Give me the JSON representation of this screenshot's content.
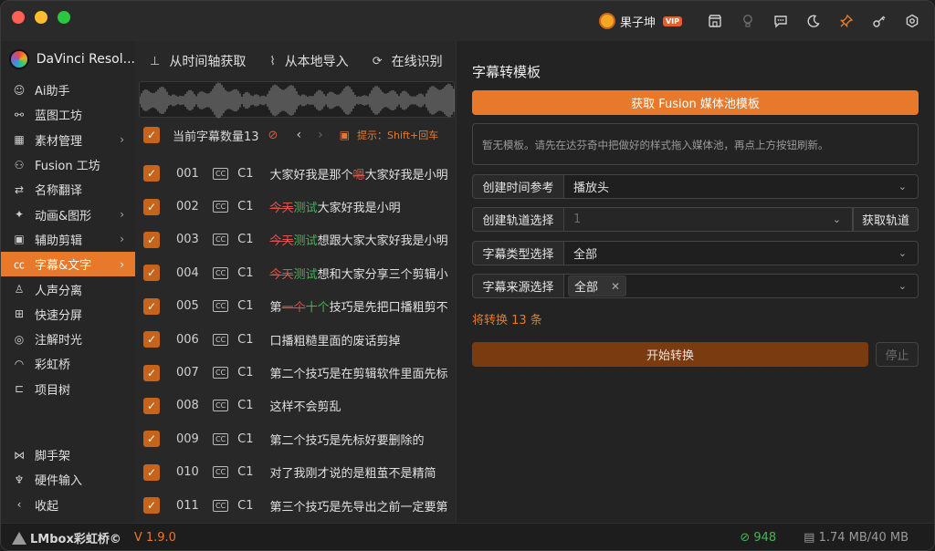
{
  "titlebar": {
    "user_name": "果子坤",
    "vip_badge": "VIP",
    "icons": [
      "store-icon",
      "lightbulb-icon",
      "message-icon",
      "moon-icon",
      "pin-icon",
      "key-icon",
      "settings-icon"
    ]
  },
  "sidebar": {
    "app_name": "DaVinci Resol...",
    "items": [
      {
        "label": "Ai助手",
        "icon": "robot-icon"
      },
      {
        "label": "蓝图工坊",
        "icon": "blueprint-icon"
      },
      {
        "label": "素材管理",
        "icon": "grid-icon",
        "has_submenu": true
      },
      {
        "label": "Fusion 工坊",
        "icon": "nodes-icon"
      },
      {
        "label": "名称翻译",
        "icon": "translate-icon"
      },
      {
        "label": "动画&图形",
        "icon": "sparkle-icon",
        "has_submenu": true
      },
      {
        "label": "辅助剪辑",
        "icon": "clip-icon",
        "has_submenu": true
      },
      {
        "label": "字幕&文字",
        "icon": "cc-icon",
        "has_submenu": true,
        "active": true
      },
      {
        "label": "人声分离",
        "icon": "person-icon"
      },
      {
        "label": "快速分屏",
        "icon": "split-icon"
      },
      {
        "label": "注解时光",
        "icon": "note-icon"
      },
      {
        "label": "彩虹桥",
        "icon": "rainbow-icon"
      },
      {
        "label": "项目树",
        "icon": "tree-icon"
      }
    ],
    "bottom_items": [
      {
        "label": "脚手架",
        "icon": "scaffold-icon"
      },
      {
        "label": "硬件输入",
        "icon": "joystick-icon"
      },
      {
        "label": "收起",
        "icon": "chevron-left-icon"
      }
    ]
  },
  "middle": {
    "tabs": [
      {
        "label": "从时间轴获取",
        "icon": "timeline-icon"
      },
      {
        "label": "从本地导入",
        "icon": "import-icon"
      },
      {
        "label": "在线识别",
        "icon": "online-icon"
      }
    ],
    "count_label": "当前字幕数量13",
    "hint": "提示：Shift+回车",
    "rows": [
      {
        "num": "001",
        "track": "C1",
        "segments": [
          {
            "t": "大家好我是那个",
            "k": ""
          },
          {
            "t": "嗯",
            "k": "del"
          },
          {
            "t": "大家好我是小明",
            "k": ""
          }
        ]
      },
      {
        "num": "002",
        "track": "C1",
        "segments": [
          {
            "t": "今天",
            "k": "del"
          },
          {
            "t": "测试",
            "k": "ins"
          },
          {
            "t": "大家好我是小明",
            "k": ""
          }
        ]
      },
      {
        "num": "003",
        "track": "C1",
        "segments": [
          {
            "t": "今天",
            "k": "del"
          },
          {
            "t": "测试",
            "k": "ins"
          },
          {
            "t": "想跟大家大家好我是小明",
            "k": ""
          }
        ]
      },
      {
        "num": "004",
        "track": "C1",
        "segments": [
          {
            "t": "今天",
            "k": "del"
          },
          {
            "t": "测试",
            "k": "ins"
          },
          {
            "t": "想和大家分享三个剪辑小",
            "k": ""
          }
        ]
      },
      {
        "num": "005",
        "track": "C1",
        "segments": [
          {
            "t": "第",
            "k": ""
          },
          {
            "t": "一个",
            "k": "del"
          },
          {
            "t": "十个",
            "k": "ins"
          },
          {
            "t": "技巧是先把口播粗剪不",
            "k": ""
          }
        ]
      },
      {
        "num": "006",
        "track": "C1",
        "segments": [
          {
            "t": "口播粗糙里面的废话剪掉",
            "k": ""
          }
        ]
      },
      {
        "num": "007",
        "track": "C1",
        "segments": [
          {
            "t": "第二个技巧是在剪辑软件里面先标",
            "k": ""
          }
        ]
      },
      {
        "num": "008",
        "track": "C1",
        "segments": [
          {
            "t": "这样不会剪乱",
            "k": ""
          }
        ]
      },
      {
        "num": "009",
        "track": "C1",
        "segments": [
          {
            "t": "第二个技巧是先标好要删除的",
            "k": ""
          }
        ]
      },
      {
        "num": "010",
        "track": "C1",
        "segments": [
          {
            "t": "对了我刚才说的是粗茧不是精简",
            "k": ""
          }
        ]
      },
      {
        "num": "011",
        "track": "C1",
        "segments": [
          {
            "t": "第三个技巧是先导出之前一定要第",
            "k": ""
          }
        ]
      }
    ]
  },
  "panel": {
    "title": "字幕转模板",
    "fetch_button": "获取 Fusion 媒体池模板",
    "notice": "暂无模板。请先在达芬奇中把做好的样式拖入媒体池，再点上方按钮刷新。",
    "fields": {
      "time_ref": {
        "label": "创建时间参考",
        "value": "播放头"
      },
      "track": {
        "label": "创建轨道选择",
        "value": "1",
        "button": "获取轨道"
      },
      "subtitle_type": {
        "label": "字幕类型选择",
        "value": "全部"
      },
      "subtitle_source": {
        "label": "字幕来源选择",
        "tag": "全部"
      }
    },
    "convert_count": "将转换 13 条",
    "start_button": "开始转换",
    "stop_button": "停止"
  },
  "statusbar": {
    "brand": "LMbox彩虹桥©",
    "version": "V 1.9.0",
    "count": "948",
    "memory": "1.74 MB/40 MB"
  },
  "colors": {
    "accent": "#e8792b",
    "success": "#3fb950",
    "danger": "#d9534f"
  }
}
